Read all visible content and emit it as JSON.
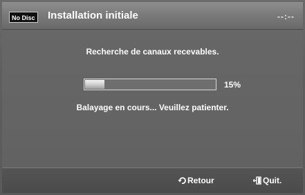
{
  "header": {
    "source_badge": "No Disc",
    "title": "Installation initiale",
    "clock": "--:--"
  },
  "main": {
    "search_message": "Recherche de canaux recevables.",
    "progress": {
      "fraction": 0.15,
      "label": "15%"
    },
    "status_message": "Balayage en cours... Veuillez patienter."
  },
  "footer": {
    "back_label": "Retour",
    "back_icon": "return-icon",
    "exit_label": "Quit.",
    "exit_icon": "exit-icon"
  }
}
